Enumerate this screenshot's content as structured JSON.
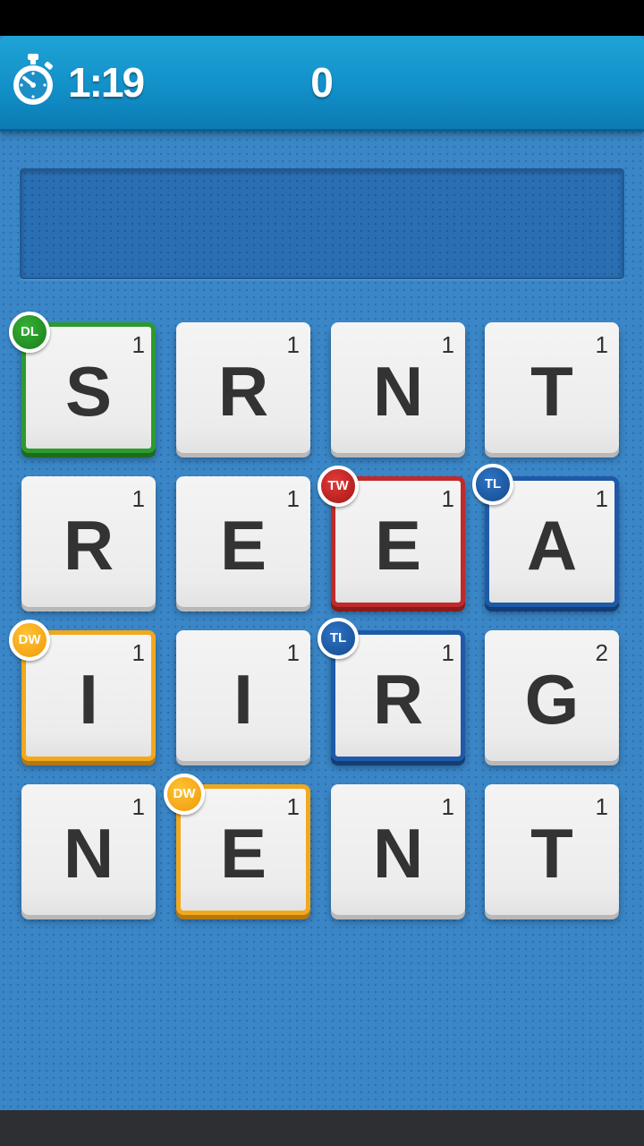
{
  "top_bar": {
    "timer": "1:19",
    "score": "0",
    "timer_icon": "stopwatch-icon"
  },
  "word_display": "",
  "colors": {
    "top_bar": "#1290c8",
    "board_background": "#3a86c6",
    "double_letter": "#2e9a2e",
    "triple_word": "#c12a2a",
    "triple_letter": "#1e5aa8",
    "double_word": "#f2a81c"
  },
  "board": {
    "rows": [
      [
        {
          "letter": "S",
          "points": "1",
          "bonus": "DL"
        },
        {
          "letter": "R",
          "points": "1",
          "bonus": ""
        },
        {
          "letter": "N",
          "points": "1",
          "bonus": ""
        },
        {
          "letter": "T",
          "points": "1",
          "bonus": ""
        }
      ],
      [
        {
          "letter": "R",
          "points": "1",
          "bonus": ""
        },
        {
          "letter": "E",
          "points": "1",
          "bonus": ""
        },
        {
          "letter": "E",
          "points": "1",
          "bonus": "TW"
        },
        {
          "letter": "A",
          "points": "1",
          "bonus": "TL"
        }
      ],
      [
        {
          "letter": "I",
          "points": "1",
          "bonus": "DW"
        },
        {
          "letter": "I",
          "points": "1",
          "bonus": ""
        },
        {
          "letter": "R",
          "points": "1",
          "bonus": "TL"
        },
        {
          "letter": "G",
          "points": "2",
          "bonus": ""
        }
      ],
      [
        {
          "letter": "N",
          "points": "1",
          "bonus": ""
        },
        {
          "letter": "E",
          "points": "1",
          "bonus": "DW"
        },
        {
          "letter": "N",
          "points": "1",
          "bonus": ""
        },
        {
          "letter": "T",
          "points": "1",
          "bonus": ""
        }
      ]
    ]
  }
}
